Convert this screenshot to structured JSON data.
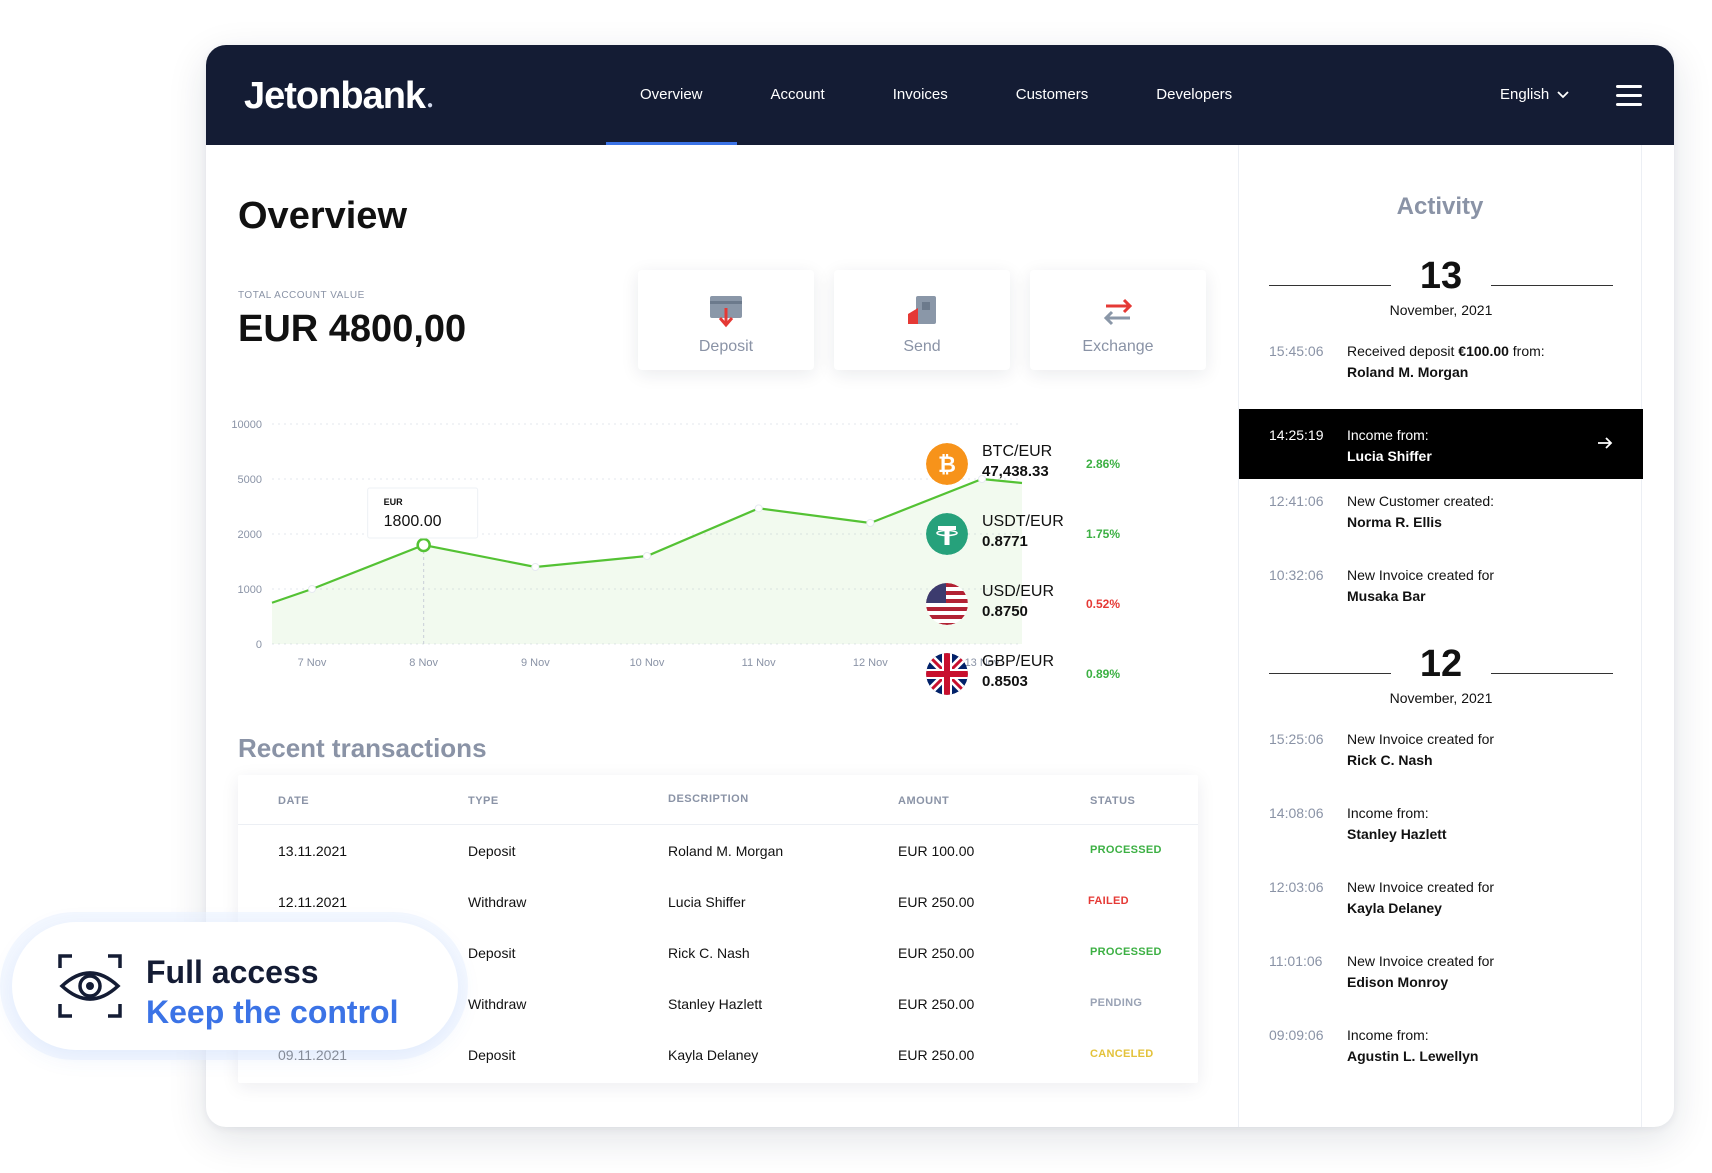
{
  "brand": {
    "name": "Jetonbank"
  },
  "nav": {
    "items": [
      "Overview",
      "Account",
      "Invoices",
      "Customers",
      "Developers"
    ],
    "active": "Overview",
    "language": "English"
  },
  "overview": {
    "title": "Overview",
    "total_label": "TOTAL ACCOUNT VALUE",
    "total_value": "EUR 4800,00",
    "actions": [
      {
        "label": "Deposit",
        "icon": "deposit-icon"
      },
      {
        "label": "Send",
        "icon": "send-icon"
      },
      {
        "label": "Exchange",
        "icon": "exchange-icon"
      }
    ]
  },
  "chart_data": {
    "type": "area",
    "x": [
      "7 Nov",
      "8 Nov",
      "9 Nov",
      "10 Nov",
      "11 Nov",
      "12 Nov",
      "13 Nov"
    ],
    "y_ticks": [
      "10000",
      "5000",
      "2000",
      "1000",
      "0"
    ],
    "values": [
      1000,
      1800,
      1400,
      1600,
      3400,
      2600,
      5000
    ],
    "tooltip": {
      "label": "EUR",
      "value": "1800.00",
      "x": "8 Nov"
    },
    "color": "#54c234"
  },
  "rates": [
    {
      "pair": "BTC/EUR",
      "price": "47,438.33",
      "change": "2.86%",
      "trend": "up",
      "icon": "bitcoin-icon",
      "color": "#f7931a"
    },
    {
      "pair": "USDT/EUR",
      "price": "0.8771",
      "change": "1.75%",
      "trend": "up",
      "icon": "tether-icon",
      "color": "#26a17b"
    },
    {
      "pair": "USD/EUR",
      "price": "0.8750",
      "change": "0.52%",
      "trend": "down",
      "icon": "us-flag-icon",
      "color": "#b22234"
    },
    {
      "pair": "GBP/EUR",
      "price": "0.8503",
      "change": "0.89%",
      "trend": "up",
      "icon": "uk-flag-icon",
      "color": "#012169"
    }
  ],
  "transactions": {
    "title": "Recent transactions",
    "columns": [
      "DATE",
      "TYPE",
      "DESCRIPTION",
      "AMOUNT",
      "STATUS"
    ],
    "rows": [
      {
        "date": "13.11.2021",
        "type": "Deposit",
        "description": "Roland M. Morgan",
        "amount": "EUR 100.00",
        "status": "PROCESSED"
      },
      {
        "date": "12.11.2021",
        "type": "Withdraw",
        "description": "Lucia Shiffer",
        "amount": "EUR 250.00",
        "status": "FAILED"
      },
      {
        "date": "",
        "type": "Deposit",
        "description": "Rick C. Nash",
        "amount": "EUR 250.00",
        "status": "PROCESSED"
      },
      {
        "date": "",
        "type": "Withdraw",
        "description": "Stanley Hazlett",
        "amount": "EUR 250.00",
        "status": "PENDING"
      },
      {
        "date": "09.11.2021",
        "type": "Deposit",
        "description": "Kayla Delaney",
        "amount": "EUR 250.00",
        "status": "CANCELED"
      }
    ],
    "status_colors": {
      "PROCESSED": "#3cb043",
      "FAILED": "#e53935",
      "PENDING": "#9aa3b5",
      "CANCELED": "#e3c23a"
    }
  },
  "activity": {
    "title": "Activity",
    "days": [
      {
        "day": "13",
        "month": "November, 2021",
        "items": [
          {
            "time": "15:45:06",
            "line1": "Received deposit ",
            "amount": "€100.00",
            "line1_suffix": " from:",
            "line2": "Roland M. Morgan"
          },
          {
            "time": "14:25:19",
            "line1": "Income from:",
            "line2": "Lucia Shiffer",
            "highlight": true
          },
          {
            "time": "12:41:06",
            "line1": "New Customer created:",
            "line2": "Norma R. Ellis"
          },
          {
            "time": "10:32:06",
            "line1": "New Invoice created for",
            "line2": "Musaka Bar"
          }
        ]
      },
      {
        "day": "12",
        "month": "November, 2021",
        "items": [
          {
            "time": "15:25:06",
            "line1": "New Invoice created for",
            "line2": "Rick C. Nash"
          },
          {
            "time": "14:08:06",
            "line1": "Income from:",
            "line2": "Stanley Hazlett"
          },
          {
            "time": "12:03:06",
            "line1": "New Invoice created for",
            "line2": "Kayla Delaney"
          },
          {
            "time": "11:01:06",
            "line1": "New Invoice created for",
            "line2": "Edison Monroy"
          },
          {
            "time": "09:09:06",
            "line1": "Income from:",
            "line2": "Agustin L. Lewellyn"
          }
        ]
      }
    ]
  },
  "promo": {
    "line1": "Full access",
    "line2": "Keep the control"
  }
}
